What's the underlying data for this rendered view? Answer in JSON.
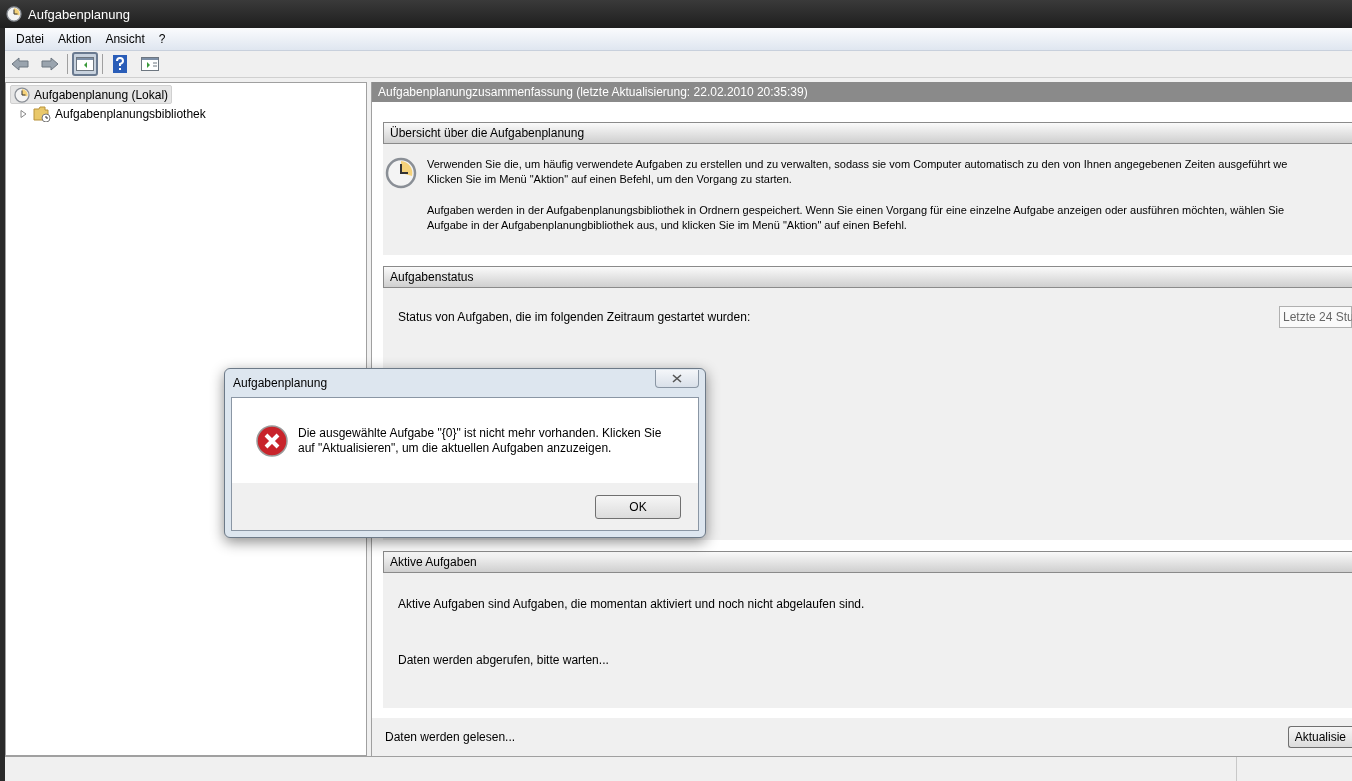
{
  "window": {
    "title": "Aufgabenplanung"
  },
  "menu": [
    "Datei",
    "Aktion",
    "Ansicht",
    "?"
  ],
  "toolbar": [
    {
      "kind": "back",
      "selected": false
    },
    {
      "kind": "forward",
      "selected": false
    },
    {
      "kind": "separator"
    },
    {
      "kind": "panel",
      "selected": true
    },
    {
      "kind": "separator"
    },
    {
      "kind": "help",
      "selected": false
    },
    {
      "kind": "action-pane",
      "selected": false
    }
  ],
  "tree": [
    {
      "label": "Aufgabenplanung (Lokal)",
      "selected": true,
      "children": [
        {
          "label": "Aufgabenplanungsbibliothek",
          "selected": false,
          "expanded": false
        }
      ]
    }
  ],
  "summary": {
    "header": "Aufgabenplanungzusammenfassung (letzte Aktualisierung: 22.02.2010 20:35:39)",
    "sections": [
      {
        "kind": "overview",
        "title": "Übersicht über die Aufgabenplanung",
        "paragraphs": [
          [
            "Verwenden Sie die, um häufig verwendete Aufgaben zu erstellen und zu verwalten, sodass sie vom Computer automatisch zu den von Ihnen angegebenen Zeiten ausgeführt we",
            "Klicken Sie im Menü \"Aktion\" auf einen Befehl, um den Vorgang zu starten."
          ],
          [
            "Aufgaben werden in der Aufgabenplanungsbibliothek in Ordnern gespeichert. Wenn Sie einen Vorgang für eine einzelne Aufgabe anzeigen oder ausführen möchten, wählen Sie",
            "Aufgabe in der Aufgabenplanungbibliothek aus, und klicken Sie im Menü \"Aktion\" auf einen Befehl."
          ]
        ]
      },
      {
        "kind": "status",
        "title": "Aufgabenstatus",
        "text": "Status von Aufgaben, die im folgenden Zeitraum gestartet wurden:",
        "dropdown": "Letzte 24 Stu"
      },
      {
        "kind": "active",
        "title": "Aktive Aufgaben",
        "text": "Aktive Aufgaben sind Aufgaben, die momentan aktiviert und noch nicht abgelaufen sind.",
        "loading": "Daten werden abgerufen, bitte warten..."
      }
    ],
    "footer": "Daten werden gelesen...",
    "refresh_button": "Aktualisie"
  },
  "dialog": {
    "title": "Aufgabenplanung",
    "message": [
      "Die ausgewählte Aufgabe \"{0}\" ist nicht mehr vorhanden. Klicken Sie",
      "auf \"Aktualisieren\", um die aktuellen Aufgaben anzuzeigen."
    ],
    "button": "OK"
  }
}
